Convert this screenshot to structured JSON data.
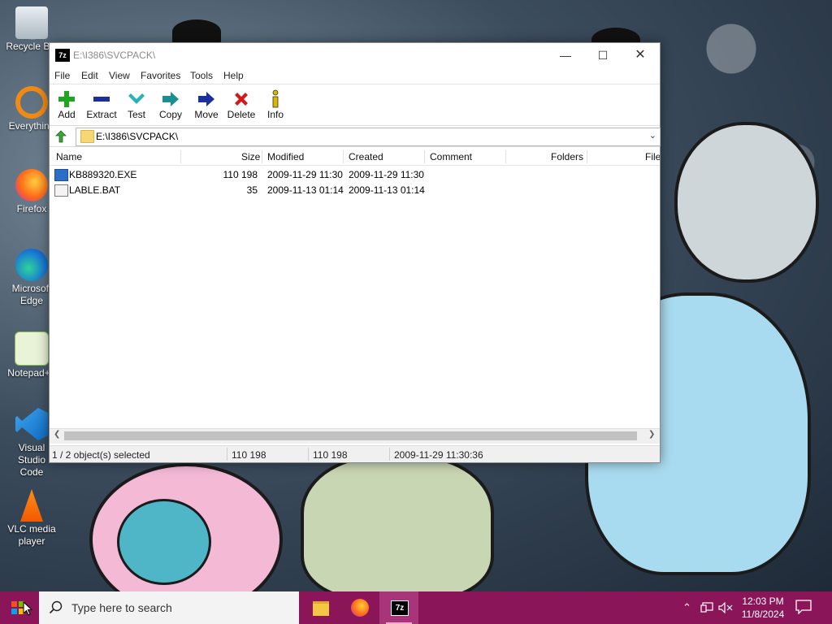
{
  "desktop": {
    "icons": [
      {
        "label": "Recycle Bin",
        "icon": "recycle-bin-icon"
      },
      {
        "label": "Everything",
        "icon": "everything-search-icon"
      },
      {
        "label": "Firefox",
        "icon": "firefox-icon"
      },
      {
        "label": "Microsoft Edge",
        "icon": "edge-icon"
      },
      {
        "label": "Notepad++",
        "icon": "notepadpp-icon"
      },
      {
        "label": "Visual Studio Code",
        "icon": "vscode-icon"
      },
      {
        "label": "VLC media player",
        "icon": "vlc-icon"
      }
    ]
  },
  "window": {
    "app_icon_text": "7z",
    "title": "E:\\I386\\SVCPACK\\",
    "controls": {
      "minimize": "—",
      "maximize": "☐",
      "close": "✕"
    }
  },
  "menu": [
    "File",
    "Edit",
    "View",
    "Favorites",
    "Tools",
    "Help"
  ],
  "toolbar": [
    {
      "label": "Add",
      "icon": "plus-icon",
      "color": "#1fa51f"
    },
    {
      "label": "Extract",
      "icon": "minus-icon",
      "color": "#1b2f9e"
    },
    {
      "label": "Test",
      "icon": "check-icon",
      "color": "#27b3b3"
    },
    {
      "label": "Copy",
      "icon": "double-arrow-icon",
      "color": "#1b8f8f"
    },
    {
      "label": "Move",
      "icon": "arrow-right-icon",
      "color": "#1b2f9e"
    },
    {
      "label": "Delete",
      "icon": "x-icon",
      "color": "#d31a1a"
    },
    {
      "label": "Info",
      "icon": "info-icon",
      "color": "#d6b800"
    }
  ],
  "address": {
    "path": "E:\\I386\\SVCPACK\\"
  },
  "columns": [
    "Name",
    "Size",
    "Modified",
    "Created",
    "Comment",
    "Folders",
    "File"
  ],
  "files": [
    {
      "name": "KB889320.EXE",
      "size": "110 198",
      "modified": "2009-11-29 11:30",
      "created": "2009-11-29 11:30",
      "icon": "exe-icon",
      "selected": true
    },
    {
      "name": "LABLE.BAT",
      "size": "35",
      "modified": "2009-11-13 01:14",
      "created": "2009-11-13 01:14",
      "icon": "bat-icon",
      "selected": false
    }
  ],
  "status": {
    "selection": "1 / 2 object(s) selected",
    "size": "110 198",
    "packed": "110 198",
    "date": "2009-11-29 11:30:36"
  },
  "taskbar": {
    "search_placeholder": "Type here to search",
    "apps": [
      {
        "name": "file-explorer",
        "icon": "folder-icon"
      },
      {
        "name": "firefox",
        "icon": "firefox-icon"
      },
      {
        "name": "7zip",
        "icon": "7zip-icon",
        "text": "7z",
        "active": true
      }
    ],
    "time": "12:03 PM",
    "date": "11/8/2024"
  }
}
